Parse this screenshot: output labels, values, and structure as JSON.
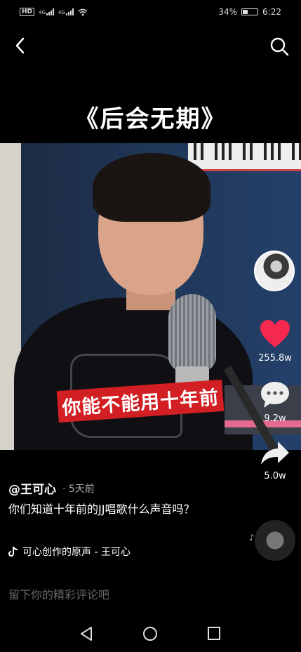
{
  "status_bar": {
    "left_icons": [
      "hd-icon",
      "4g-signal-icon",
      "4g-signal-icon",
      "wifi-icon"
    ],
    "sig_label_1": "4G",
    "sig_label_2": "4G",
    "battery_percent": "34%",
    "battery_level": 0.34,
    "time": "6:22"
  },
  "video": {
    "title": "《后会无期》",
    "subtitle": "你能不能用十年前"
  },
  "actions": {
    "likes": "255.8w",
    "comments": "9.2w",
    "shares": "5.0w"
  },
  "post": {
    "author": "@王可心",
    "time_ago": "· 5天前",
    "description": "你们知道十年前的JJ唱歌什么声音吗？",
    "music": "可心创作的原声 - 王可心"
  },
  "comment_box": {
    "placeholder": "留下你的精彩评论吧"
  },
  "colors": {
    "like_heart": "#f5284f",
    "subtitle_bg": "#d11f23",
    "background": "#000000"
  }
}
